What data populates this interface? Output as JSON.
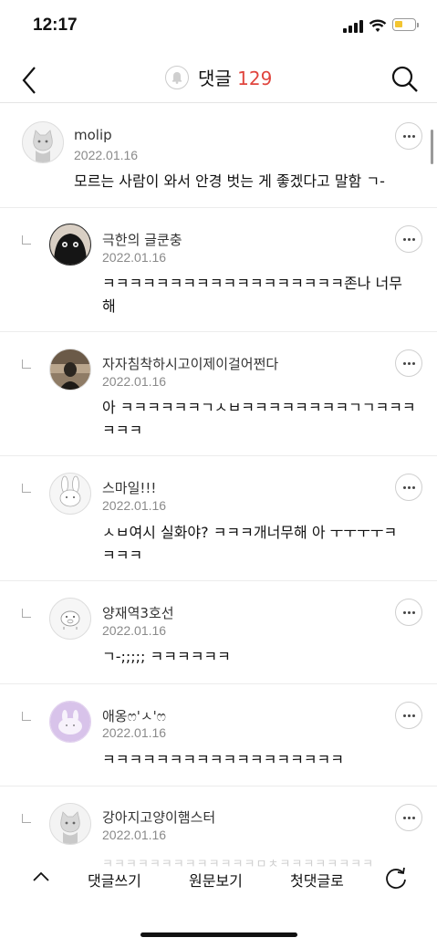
{
  "status_bar": {
    "time": "12:17"
  },
  "header": {
    "title": "댓글",
    "count": "129"
  },
  "comments": [
    {
      "author": "molip",
      "date": "2022.01.16",
      "lines": [
        "모르는 사람이 와서 안경 벗는 게 좋겠다고 말함 ㄱ-"
      ]
    },
    {
      "author": "극한의 글쿤충",
      "date": "2022.01.16",
      "lines": [
        "ㅋㅋㅋㅋㅋㅋㅋㅋㅋㅋㅋㅋㅋㅋㅋㅋㅋㅋ존나 너무",
        "해"
      ]
    },
    {
      "author": "자자침착하시고이제이걸어쩐다",
      "date": "2022.01.16",
      "lines": [
        "아 ㅋㅋㅋㅋㅋㅋㄱㅅㅂㅋㅋㅋㅋㅋㅋㅋㅋㄱㄱㅋㅋㅋ",
        "ㅋㅋㅋ"
      ]
    },
    {
      "author": "스마일!!!",
      "date": "2022.01.16",
      "lines": [
        "ㅅㅂ여시 실화야? ㅋㅋㅋ개너무해 아 ㅜㅜㅜㅜㅋ",
        "ㅋㅋㅋ"
      ]
    },
    {
      "author": "양재역3호선",
      "date": "2022.01.16",
      "lines": [
        "ㄱ-;;;;; ㅋㅋㅋㅋㅋㅋ"
      ]
    },
    {
      "author": "애옹ෆ'ㅅ'ෆ",
      "date": "2022.01.16",
      "lines": [
        "ㅋㅋㅋㅋㅋㅋㅋㅋㅋㅋㅋㅋㅋㅋㅋㅋㅋㅋ"
      ]
    },
    {
      "author": "강아지고양이햄스터",
      "date": "2022.01.16",
      "lines": [
        "ㅋㅋㅋㅋㅋㅋㅋㅋㅋㅋㅋㅋㅋㅁㅊㅋㅋㅋㅋㅋㅋㅋㅋ"
      ]
    }
  ],
  "toolbar": {
    "write_label": "댓글쓰기",
    "original_label": "원문보기",
    "first_label": "첫댓글로"
  },
  "colors": {
    "accent": "#e0453e",
    "divider": "#ececec",
    "date": "#8a8a8a"
  },
  "icons": [
    "back-icon",
    "bell-icon",
    "search-icon",
    "more-icon",
    "reply-icon",
    "chevron-up-icon",
    "refresh-icon"
  ]
}
